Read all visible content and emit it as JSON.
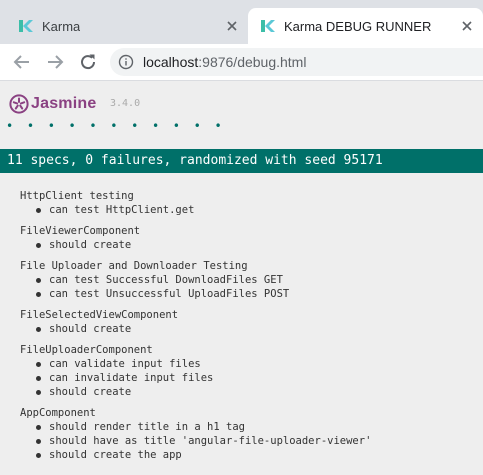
{
  "browser": {
    "tabs": [
      {
        "title": "Karma",
        "active": false,
        "favicon": "karma-logo-icon"
      },
      {
        "title": "Karma DEBUG RUNNER",
        "active": true,
        "favicon": "karma-logo-icon"
      }
    ],
    "url_host": "localhost",
    "url_rest": ":9876/debug.html"
  },
  "jasmine": {
    "name": "Jasmine",
    "version": "3.4.0",
    "dots": "• • • • • • • • • • •",
    "summary": "11 specs, 0 failures, randomized with seed 95171",
    "colors": {
      "brand": "#8a4182",
      "passed": "#007069"
    }
  },
  "suites": [
    {
      "name": "HttpClient testing",
      "specs": [
        "can test HttpClient.get"
      ]
    },
    {
      "name": "FileViewerComponent",
      "specs": [
        "should create"
      ]
    },
    {
      "name": "File Uploader and Downloader Testing",
      "specs": [
        "can test Successful DownloadFiles GET",
        "can test Unsuccessful UploadFiles POST"
      ]
    },
    {
      "name": "FileSelectedViewComponent",
      "specs": [
        "should create"
      ]
    },
    {
      "name": "FileUploaderComponent",
      "specs": [
        "can validate input files",
        "can invalidate input files",
        "should create"
      ]
    },
    {
      "name": "AppComponent",
      "specs": [
        "should render title in a h1 tag",
        "should have as title 'angular-file-uploader-viewer'",
        "should create the app"
      ]
    }
  ]
}
